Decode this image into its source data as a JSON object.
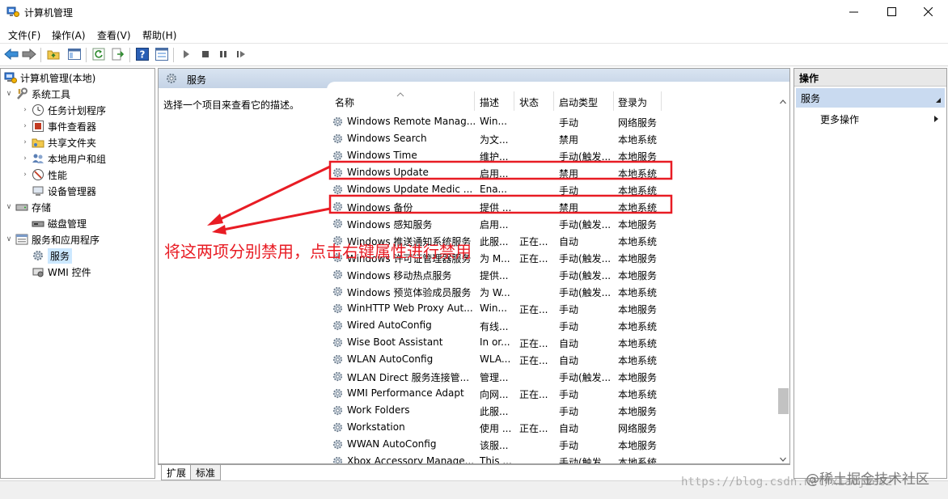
{
  "window": {
    "title": "计算机管理",
    "minimize_icon": "minimize-icon",
    "maximize_icon": "maximize-icon",
    "close_icon": "close-icon"
  },
  "menu": [
    "文件(F)",
    "操作(A)",
    "查看(V)",
    "帮助(H)"
  ],
  "toolbar_icons": [
    "back-icon",
    "forward-icon",
    "folder-up-icon",
    "show-hide-tree-icon",
    "refresh-icon",
    "export-icon",
    "help-icon",
    "properties-icon",
    "play-icon",
    "stop-icon",
    "pause-icon",
    "restart-icon"
  ],
  "tree": {
    "root": "计算机管理(本地)",
    "items": [
      {
        "label": "系统工具",
        "icon": "tools-icon"
      },
      {
        "label": "任务计划程序",
        "icon": "clock-icon"
      },
      {
        "label": "事件查看器",
        "icon": "event-viewer-icon"
      },
      {
        "label": "共享文件夹",
        "icon": "shared-folder-icon"
      },
      {
        "label": "本地用户和组",
        "icon": "users-icon"
      },
      {
        "label": "性能",
        "icon": "performance-icon"
      },
      {
        "label": "设备管理器",
        "icon": "device-manager-icon"
      },
      {
        "label": "存储",
        "icon": "storage-icon"
      },
      {
        "label": "磁盘管理",
        "icon": "disk-icon"
      },
      {
        "label": "服务和应用程序",
        "icon": "services-apps-icon"
      },
      {
        "label": "服务",
        "icon": "services-icon"
      },
      {
        "label": "WMI 控件",
        "icon": "wmi-icon"
      }
    ]
  },
  "services_panel": {
    "title": "服务",
    "description_hint": "选择一个项目来查看它的描述。",
    "columns": [
      "名称",
      "描述",
      "状态",
      "启动类型",
      "登录为"
    ],
    "rows": [
      {
        "name": "Windows Remote Manag...",
        "desc": "Win...",
        "status": "",
        "startup": "手动",
        "logon": "网络服务"
      },
      {
        "name": "Windows Search",
        "desc": "为文...",
        "status": "",
        "startup": "禁用",
        "logon": "本地系统"
      },
      {
        "name": "Windows Time",
        "desc": "维护...",
        "status": "",
        "startup": "手动(触发...",
        "logon": "本地服务"
      },
      {
        "name": "Windows Update",
        "desc": "启用...",
        "status": "",
        "startup": "禁用",
        "logon": "本地系统"
      },
      {
        "name": "Windows Update Medic ...",
        "desc": "Ena...",
        "status": "",
        "startup": "手动",
        "logon": "本地系统"
      },
      {
        "name": "Windows 备份",
        "desc": "提供 ...",
        "status": "",
        "startup": "禁用",
        "logon": "本地系统"
      },
      {
        "name": "Windows 感知服务",
        "desc": "启用...",
        "status": "",
        "startup": "手动(触发...",
        "logon": "本地服务"
      },
      {
        "name": "Windows 推送通知系统服务",
        "desc": "此服...",
        "status": "正在...",
        "startup": "自动",
        "logon": "本地系统"
      },
      {
        "name": "Windows 许可证管理器服务",
        "desc": "为 M...",
        "status": "正在...",
        "startup": "手动(触发...",
        "logon": "本地服务"
      },
      {
        "name": "Windows 移动热点服务",
        "desc": "提供...",
        "status": "",
        "startup": "手动(触发...",
        "logon": "本地服务"
      },
      {
        "name": "Windows 预览体验成员服务",
        "desc": "为 W...",
        "status": "",
        "startup": "手动(触发...",
        "logon": "本地系统"
      },
      {
        "name": "WinHTTP Web Proxy Aut...",
        "desc": "Win...",
        "status": "正在...",
        "startup": "手动",
        "logon": "本地服务"
      },
      {
        "name": "Wired AutoConfig",
        "desc": "有线...",
        "status": "",
        "startup": "手动",
        "logon": "本地系统"
      },
      {
        "name": "Wise Boot Assistant",
        "desc": "In or...",
        "status": "正在...",
        "startup": "自动",
        "logon": "本地系统"
      },
      {
        "name": "WLAN AutoConfig",
        "desc": "WLA...",
        "status": "正在...",
        "startup": "自动",
        "logon": "本地系统"
      },
      {
        "name": "WLAN Direct 服务连接管...",
        "desc": "管理...",
        "status": "",
        "startup": "手动(触发...",
        "logon": "本地服务"
      },
      {
        "name": "WMI Performance Adapt",
        "desc": "向网...",
        "status": "正在...",
        "startup": "手动",
        "logon": "本地系统"
      },
      {
        "name": "Work Folders",
        "desc": "此服...",
        "status": "",
        "startup": "手动",
        "logon": "本地服务"
      },
      {
        "name": "Workstation",
        "desc": "使用 ...",
        "status": "正在...",
        "startup": "自动",
        "logon": "网络服务"
      },
      {
        "name": "WWAN AutoConfig",
        "desc": "该服...",
        "status": "",
        "startup": "手动",
        "logon": "本地服务"
      },
      {
        "name": "Xbox Accessory Manage...",
        "desc": "This ...",
        "status": "",
        "startup": "手动(触发...",
        "logon": "本地系统"
      }
    ],
    "tabs": [
      "扩展",
      "标准"
    ]
  },
  "actions_pane": {
    "header": "操作",
    "section": "服务",
    "more_actions": "更多操作"
  },
  "annotation": {
    "text": "将这两项分别禁用，点击右键属性进行禁用",
    "color": "#e81c24"
  },
  "watermark": {
    "url": "https://blog.csdn.net/xiaojie82",
    "site": "@稀土掘金技术社区"
  }
}
